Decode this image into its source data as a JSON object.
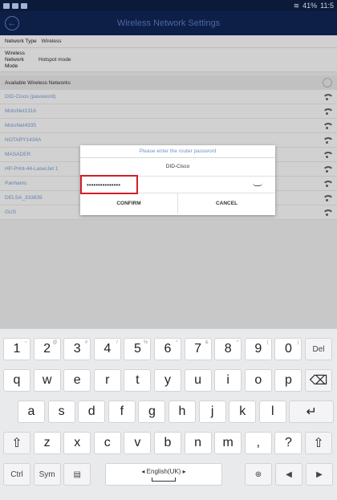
{
  "status_bar": {
    "time": "11:5",
    "battery": "41%"
  },
  "header": {
    "title": "Wireless Network Settings",
    "back_symbol": "←"
  },
  "info": {
    "network_type_label": "Network Type",
    "network_type_value": "Wireless",
    "network_mode_label": "Wireless Network Mode",
    "network_mode_value": "Hotspot mode"
  },
  "networks": {
    "header": "Available Wireless Networks",
    "items": [
      {
        "ssid": "DID-Cisco (password)"
      },
      {
        "ssid": "MotoNet1316"
      },
      {
        "ssid": "MotoNet4335"
      },
      {
        "ssid": "NOTARY1434A"
      },
      {
        "ssid": "MASADER"
      },
      {
        "ssid": "HP-Print-44-LaserJet 1"
      },
      {
        "ssid": "Panhamc"
      },
      {
        "ssid": "DELSA_333839"
      },
      {
        "ssid": "GUS"
      }
    ]
  },
  "dialog": {
    "prompt": "Please enter the router password",
    "ssid": "DID-Cisco",
    "password_mask": "•••••••••••••••",
    "confirm": "CONFIRM",
    "cancel": "CANCEL"
  },
  "keyboard": {
    "row1": [
      {
        "k": "1",
        "s": "~"
      },
      {
        "k": "2",
        "s": "@"
      },
      {
        "k": "3",
        "s": "#"
      },
      {
        "k": "4",
        "s": "/"
      },
      {
        "k": "5",
        "s": "%"
      },
      {
        "k": "6",
        "s": "^"
      },
      {
        "k": "7",
        "s": "&"
      },
      {
        "k": "8",
        "s": "*"
      },
      {
        "k": "9",
        "s": "("
      },
      {
        "k": "0",
        "s": ")"
      },
      {
        "k": "Del",
        "s": ""
      }
    ],
    "row2": [
      "q",
      "w",
      "e",
      "r",
      "t",
      "y",
      "u",
      "i",
      "o",
      "p",
      "⌫"
    ],
    "row3": [
      "a",
      "s",
      "d",
      "f",
      "g",
      "h",
      "j",
      "k",
      "l",
      "↵"
    ],
    "row4": [
      "⇧",
      "z",
      "x",
      "c",
      "v",
      "b",
      "n",
      "m",
      ",",
      "?",
      "⇧"
    ],
    "row5": {
      "ctrl": "Ctrl",
      "sym": "Sym",
      "clip": "▤",
      "space": "◂ English(UK) ▸",
      "globe": "⊕",
      "left": "◀",
      "right": "▶"
    }
  }
}
